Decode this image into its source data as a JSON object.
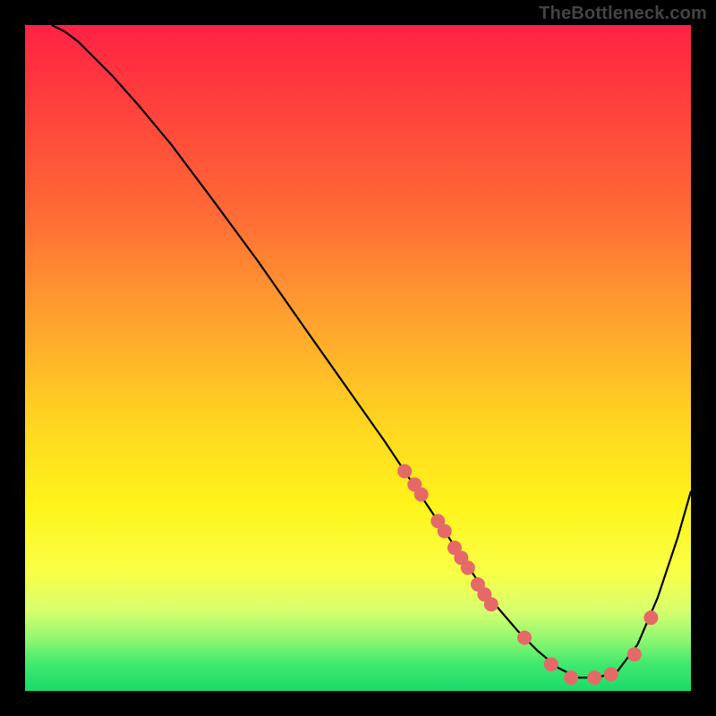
{
  "watermark": "TheBottleneck.com",
  "colors": {
    "page_bg": "#000000",
    "gradient_top": "#ff2244",
    "gradient_mid": "#ffd022",
    "gradient_bottom": "#18db6a",
    "curve": "#000000",
    "marker": "#e56a67"
  },
  "chart_data": {
    "type": "line",
    "title": "",
    "xlabel": "",
    "ylabel": "",
    "xlim": [
      0,
      100
    ],
    "ylim": [
      0,
      100
    ],
    "series": [
      {
        "name": "curve",
        "x": [
          4,
          6,
          8,
          10,
          13,
          17,
          22,
          28,
          35,
          42,
          48,
          54,
          58,
          62,
          65,
          68,
          71,
          74,
          77,
          80,
          83,
          86,
          89,
          92,
          95,
          98,
          100
        ],
        "y": [
          100,
          99,
          97.5,
          95.5,
          92.5,
          88,
          82,
          74,
          64.5,
          54.5,
          46,
          37.5,
          31.5,
          25.5,
          21,
          16.5,
          12.5,
          9,
          6,
          3.5,
          2,
          2,
          3,
          7,
          14,
          23,
          30
        ]
      }
    ],
    "markers": {
      "x": [
        57,
        58.5,
        59.5,
        62,
        63,
        64.5,
        65.5,
        66.5,
        68,
        69,
        70,
        75,
        79,
        82,
        85.5,
        88,
        91.5,
        94
      ],
      "y": [
        33,
        31,
        29.5,
        25.5,
        24,
        21.5,
        20,
        18.5,
        16,
        14.5,
        13,
        8,
        4,
        2,
        2,
        2.5,
        5.5,
        11
      ]
    }
  }
}
